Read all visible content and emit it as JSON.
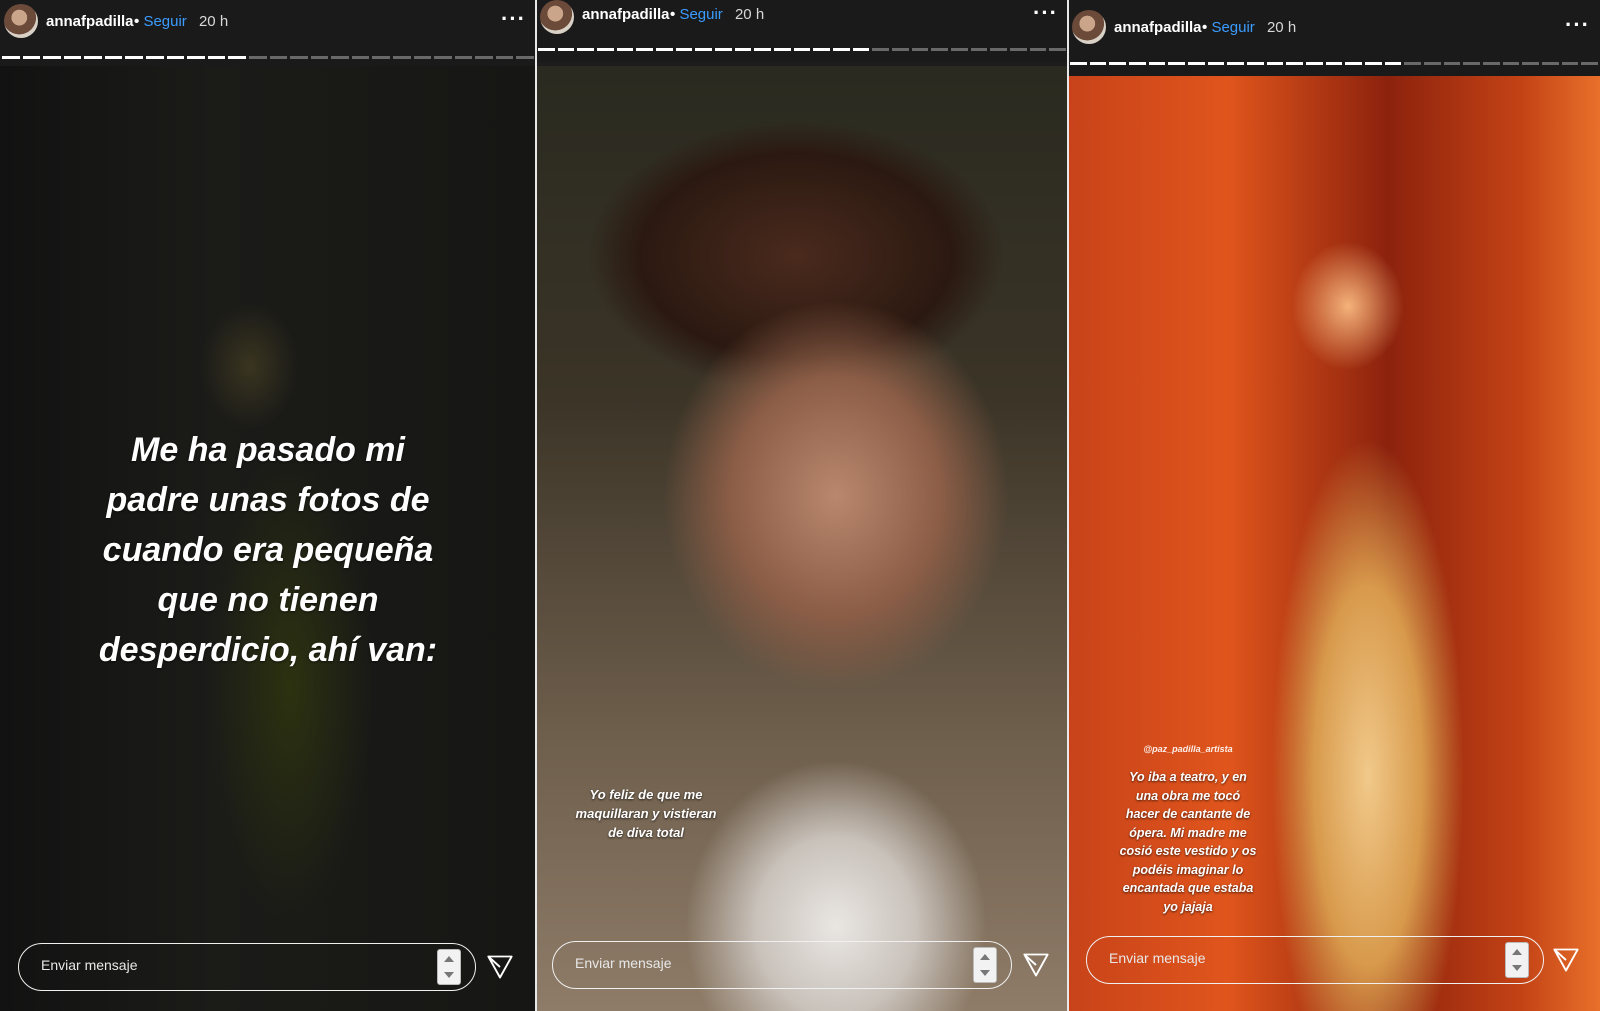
{
  "stories": [
    {
      "username": "annafpadilla",
      "separator": "•",
      "follow_label": "Seguir",
      "time": "20 h",
      "more": "···",
      "caption_lines": [
        "Me ha pasado mi",
        "padre unas fotos  de",
        "cuando era pequeña",
        "que no tienen",
        "desperdicio, ahí van:"
      ],
      "message_placeholder": "Enviar mensaje"
    },
    {
      "username": "annafpadilla",
      "separator": "•",
      "follow_label": "Seguir",
      "time": "20 h",
      "more": "···",
      "caption_lines": [
        "Yo feliz de que me",
        "maquillaran y vistieran",
        "de diva total"
      ],
      "message_placeholder": "Enviar mensaje"
    },
    {
      "username": "annafpadilla",
      "separator": "•",
      "follow_label": "Seguir",
      "time": "20 h",
      "more": "···",
      "mention": "@paz_padilla_artista",
      "caption_lines": [
        "Yo iba a teatro, y en",
        "una obra me tocó",
        "hacer de cantante de",
        "ópera. Mi madre me",
        "cosió este vestido y os",
        "podéis imaginar lo",
        "encantada que estaba",
        "yo jajaja"
      ],
      "message_placeholder": "Enviar mensaje"
    }
  ],
  "colors": {
    "follow": "#3b9cff",
    "background": "#1a1a1a",
    "text": "#ffffff"
  }
}
